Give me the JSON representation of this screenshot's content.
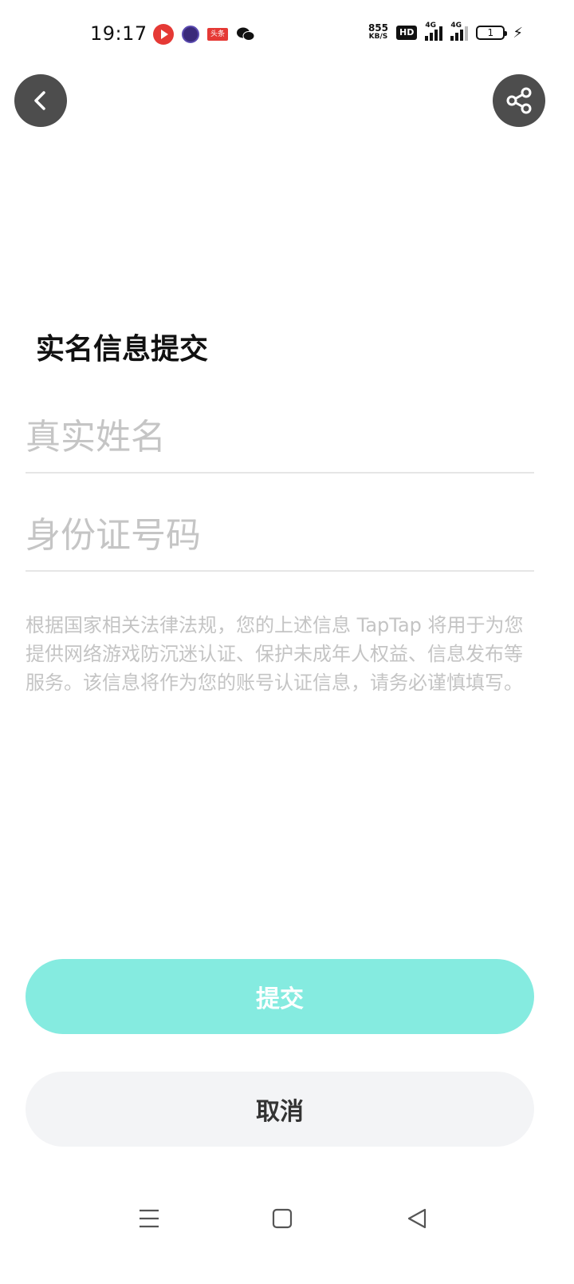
{
  "status_bar": {
    "time": "19:17",
    "notifications": [
      "video-app-icon",
      "circle-app-icon",
      "toutiao-icon",
      "wechat-icon"
    ],
    "toutiao_label": "头条",
    "net_speed": "855",
    "net_speed_unit": "KB/S",
    "hd_label": "HD",
    "signal1_label": "4G",
    "signal2_label": "4G",
    "battery_level": "1"
  },
  "header": {
    "back_icon": "chevron-left-icon",
    "share_icon": "share-icon"
  },
  "form": {
    "title": "实名信息提交",
    "name_placeholder": "真实姓名",
    "name_value": "",
    "id_placeholder": "身份证号码",
    "id_value": "",
    "notice": "根据国家相关法律法规，您的上述信息 TapTap 将用于为您提供网络游戏防沉迷认证、保护未成年人权益、信息发布等服务。该信息将作为您的账号认证信息，请务必谨慎填写。"
  },
  "actions": {
    "submit_label": "提交",
    "cancel_label": "取消"
  },
  "colors": {
    "submit_bg": "#85ebe0",
    "cancel_bg": "#f3f4f6",
    "round_button_bg": "#4d4d4d",
    "placeholder": "#c5c5c5"
  },
  "nav_bar": {
    "items": [
      "menu-icon",
      "home-square-icon",
      "back-triangle-icon"
    ]
  }
}
